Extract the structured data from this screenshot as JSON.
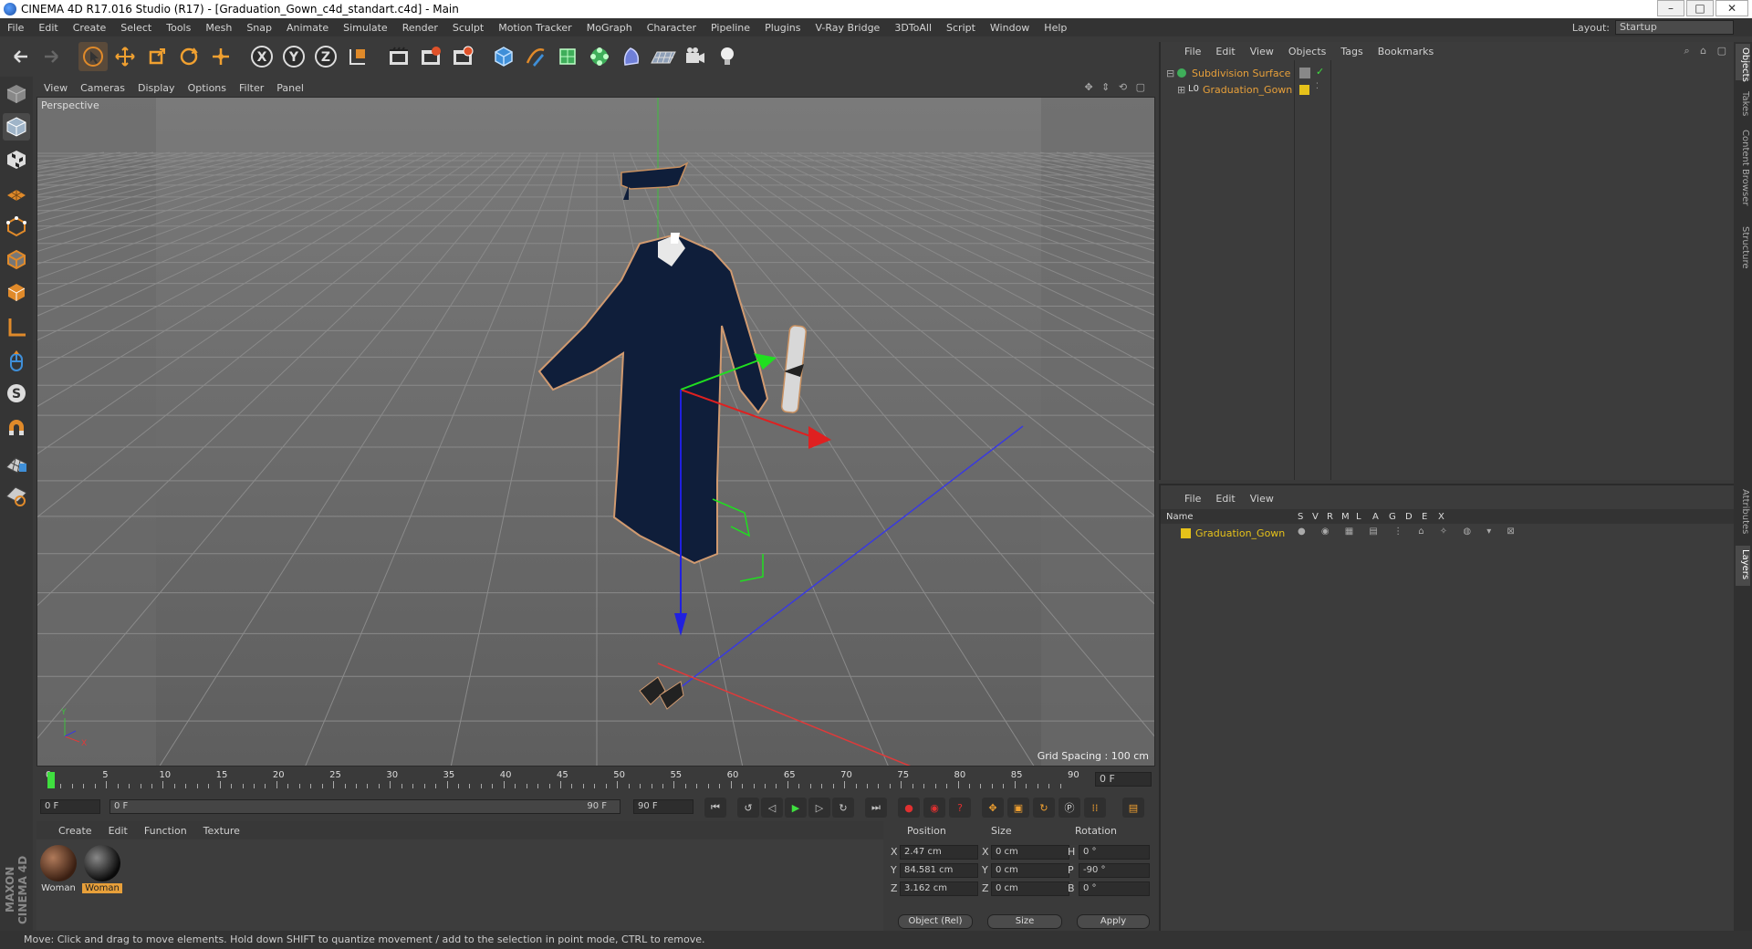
{
  "window": {
    "title": "CINEMA 4D R17.016 Studio (R17) - [Graduation_Gown_c4d_standart.c4d] - Main"
  },
  "menubar": {
    "items": [
      "File",
      "Edit",
      "Create",
      "Select",
      "Tools",
      "Mesh",
      "Snap",
      "Animate",
      "Simulate",
      "Render",
      "Sculpt",
      "Motion Tracker",
      "MoGraph",
      "Character",
      "Pipeline",
      "Plugins",
      "V-Ray Bridge",
      "3DToAll",
      "Script",
      "Window",
      "Help"
    ],
    "layout_label": "Layout:",
    "layout_value": "Startup"
  },
  "toolbar": {
    "icons": [
      "undo-icon",
      "redo-icon",
      "select-arrow-icon",
      "move-icon",
      "scale-icon",
      "rotate-icon",
      "live-select-icon",
      "x-axis-icon",
      "y-axis-icon",
      "z-axis-icon",
      "world-coord-icon",
      "render-view-icon",
      "render-picture-icon",
      "render-settings-icon",
      "cube-icon",
      "pen-icon",
      "subdivision-icon",
      "cloner-icon",
      "deformer-icon",
      "floor-icon",
      "camera-icon",
      "light-icon"
    ]
  },
  "left_tools": {
    "icons": [
      "model-mode-icon",
      "object-mode-icon",
      "texture-mode-icon",
      "workplane-icon",
      "points-mode-icon",
      "edges-mode-icon",
      "polygons-mode-icon",
      "axis-icon",
      "tweak-icon",
      "solo-icon",
      "magnet-icon",
      "snap-grid-icon",
      "snap-lock-icon"
    ]
  },
  "viewport": {
    "menu": [
      "View",
      "Cameras",
      "Display",
      "Options",
      "Filter",
      "Panel"
    ],
    "label": "Perspective",
    "grid_spacing": "Grid Spacing : 100 cm"
  },
  "timeline": {
    "ticks": [
      "0",
      "5",
      "10",
      "15",
      "20",
      "25",
      "30",
      "35",
      "40",
      "45",
      "50",
      "55",
      "60",
      "65",
      "70",
      "75",
      "80",
      "85",
      "90"
    ],
    "current_frame": "0 F"
  },
  "transport": {
    "start_field": "0 F",
    "range_start": "0 F",
    "range_end": "90 F",
    "end_field": "90 F"
  },
  "materials": {
    "menu": [
      "Create",
      "Edit",
      "Function",
      "Texture"
    ],
    "items": [
      {
        "name": "Woman",
        "selected": false
      },
      {
        "name": "Woman",
        "selected": true
      }
    ]
  },
  "coordinates": {
    "headers": {
      "position": "Position",
      "size": "Size",
      "rotation": "Rotation"
    },
    "rows": [
      {
        "axis": "X",
        "pos": "2.47 cm",
        "size_axis": "X",
        "size": "0 cm",
        "rot_axis": "H",
        "rot": "0 °"
      },
      {
        "axis": "Y",
        "pos": "84.581 cm",
        "size_axis": "Y",
        "size": "0 cm",
        "rot_axis": "P",
        "rot": "-90 °"
      },
      {
        "axis": "Z",
        "pos": "3.162 cm",
        "size_axis": "Z",
        "size": "0 cm",
        "rot_axis": "B",
        "rot": "0 °"
      }
    ],
    "mode": "Object (Rel)",
    "size_mode": "Size",
    "apply": "Apply"
  },
  "object_manager": {
    "menu": [
      "File",
      "Edit",
      "View",
      "Objects",
      "Tags",
      "Bookmarks"
    ],
    "objects": [
      {
        "name": "Subdivision Surface"
      },
      {
        "name": "Graduation_Gown"
      }
    ]
  },
  "layer_manager": {
    "menu": [
      "File",
      "Edit",
      "View"
    ],
    "columns": [
      "Name",
      "S",
      "V",
      "R",
      "M",
      "L",
      "A",
      "G",
      "D",
      "E",
      "X"
    ],
    "layers": [
      {
        "name": "Graduation_Gown",
        "color": "#e6c21a"
      }
    ]
  },
  "right_tabs": [
    "Objects",
    "Takes",
    "Content Browser",
    "Structure",
    "Attributes",
    "Layers"
  ],
  "status": "Move: Click and drag to move elements. Hold down SHIFT to quantize movement / add to the selection in point mode, CTRL to remove.",
  "brand": "MAXON CINEMA 4D",
  "colors": {
    "accent_orange": "#e8a03a",
    "layer_yellow": "#e6c21a",
    "gown_navy": "#0f1e3a"
  }
}
